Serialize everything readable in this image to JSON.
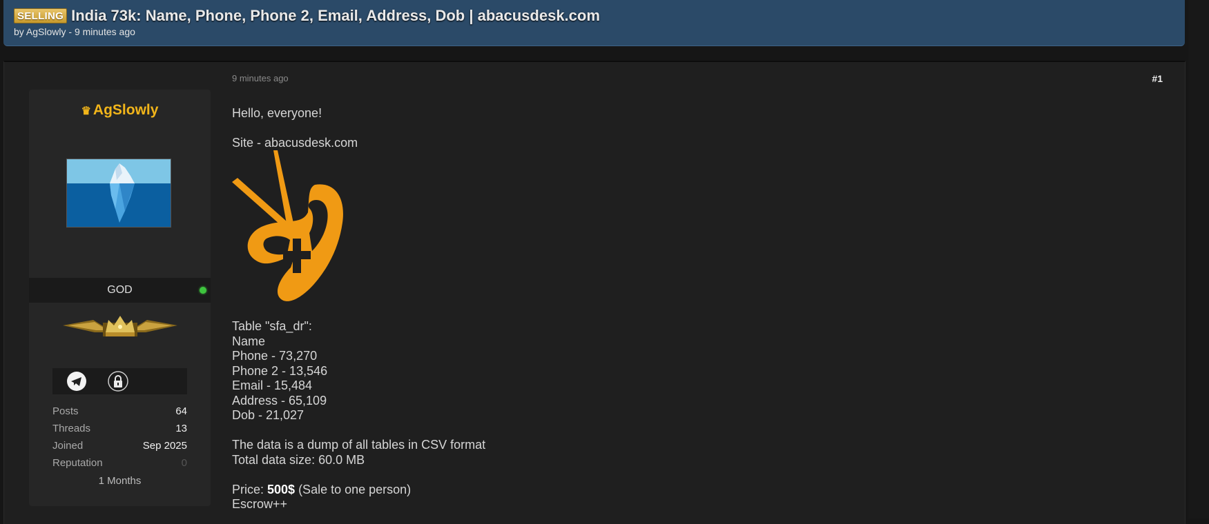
{
  "header": {
    "badge": "SELLING",
    "title": "India 73k: Name, Phone, Phone 2, Email, Address, Dob | abacusdesk.com",
    "byline_prefix": "by ",
    "author": "AgSlowly",
    "byline_suffix": " - 9 minutes ago"
  },
  "user": {
    "username": "AgSlowly",
    "rank": "GOD",
    "online": true,
    "stats": [
      {
        "label": "Posts",
        "value": "64"
      },
      {
        "label": "Threads",
        "value": "13"
      },
      {
        "label": "Joined",
        "value": "Sep 2025"
      },
      {
        "label": "Reputation",
        "value": "0"
      }
    ],
    "membership": "1 Months"
  },
  "post": {
    "time": "9 minutes ago",
    "number": "#1",
    "greeting": "Hello, everyone!",
    "site_line": "Site - abacusdesk.com",
    "table_lines": [
      "Table \"sfa_dr\":",
      "Name",
      "Phone - 73,270",
      "Phone 2 - 13,546",
      "Email - 15,484",
      "Address - 65,109",
      "Dob - 21,027"
    ],
    "format_line": "The data is a dump of all tables in CSV format",
    "size_line": "Total data size: 60.0 MB",
    "price_label": "Price: ",
    "price_value": "500$",
    "price_note": " (Sale to one person)",
    "escrow": "Escrow++"
  },
  "colors": {
    "header_bg": "#2b4a68",
    "username": "#f2b51a",
    "online": "#3ec43e",
    "logo": "#f09a14"
  },
  "icons": [
    "crown-icon",
    "telegram-icon",
    "lock-icon",
    "online-status-icon",
    "rank-emblem-icon"
  ]
}
